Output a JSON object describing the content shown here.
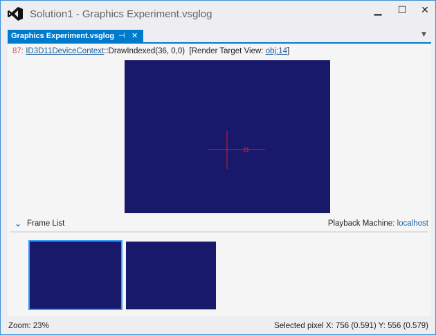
{
  "window": {
    "title": "Solution1 - Graphics Experiment.vsglog",
    "minimize": "▁",
    "maximize": "☐",
    "close": "✕"
  },
  "tab": {
    "label": "Graphics Experiment.vsglog",
    "pin": "⊣",
    "close": "✕",
    "overflow": "▼"
  },
  "event": {
    "index": "87:",
    "interface": "ID3D11DeviceContext",
    "call": "::DrawIndexed(36, 0,0)  [Render Target View: ",
    "target": "obj:14",
    "end": "]"
  },
  "frame_list": {
    "toggle": "⌄",
    "label": "Frame List",
    "playback_label": "Playback Machine:",
    "playback_value": "localhost",
    "frames": 2,
    "selected": 0
  },
  "status": {
    "zoom": "Zoom: 23%",
    "pixel": "Selected pixel X: 756 (0.591) Y: 556 (0.579)"
  },
  "colors": {
    "accent": "#007acc",
    "render_bg": "#19196c",
    "crosshair": "#d0202a"
  }
}
